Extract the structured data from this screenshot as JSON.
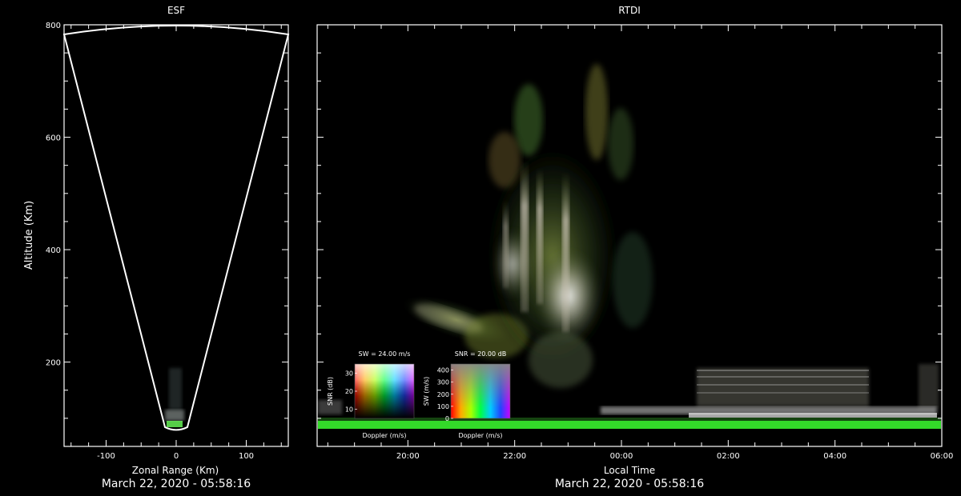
{
  "chart_data": [
    {
      "type": "scatter",
      "title": "ESF",
      "xlabel": "Zonal Range (Km)",
      "ylabel": "Altitude (Km)",
      "xlim": [
        -160,
        160
      ],
      "ylim": [
        50,
        800
      ],
      "x_ticks": [
        -100,
        0,
        100
      ],
      "y_ticks": [
        200,
        400,
        600,
        800
      ],
      "grid": false,
      "fan_beam": {
        "origin_altitude": 80,
        "edge_x_at_top": [
          -160,
          160
        ],
        "top_altitude": 800
      },
      "echo_region": {
        "x": [
          -20,
          15
        ],
        "altitude": [
          80,
          185
        ]
      },
      "footer": "March 22, 2020 - 05:58:16"
    },
    {
      "type": "heatmap",
      "title": "RTDI",
      "xlabel": "Local Time",
      "ylabel": "",
      "x_ticks": [
        "20:00",
        "22:00",
        "00:00",
        "02:00",
        "04:00",
        "06:00"
      ],
      "x_range_hours": [
        18.3,
        30.0
      ],
      "ylim": [
        50,
        800
      ],
      "y_ticks": [
        200,
        400,
        600,
        800
      ],
      "grid": false,
      "echo_events": [
        {
          "name": "plume",
          "time_hours": [
            21.6,
            23.5
          ],
          "altitude": [
            170,
            710
          ]
        },
        {
          "name": "bottomside_layer",
          "time_hours": [
            19.2,
            22.9
          ],
          "altitude": [
            180,
            280
          ]
        },
        {
          "name": "e_region_band",
          "time_hours": [
            18.3,
            30.0
          ],
          "altitude": [
            80,
            88
          ]
        },
        {
          "name": "post_midnight_layer",
          "time_hours": [
            25.3,
            29.5
          ],
          "altitude": [
            100,
            145
          ]
        }
      ],
      "legend_sw": {
        "title": "SW = 24.00 m/s",
        "ylabel": "SNR (dB)",
        "xlabel": "Doppler (m/s)",
        "y_ticks": [
          10,
          20,
          30
        ]
      },
      "legend_snr": {
        "title": "SNR = 20.00 dB",
        "ylabel": "SW (m/s)",
        "xlabel": "Doppler (m/s)",
        "y_ticks": [
          0,
          100,
          200,
          300,
          400
        ]
      },
      "footer": "March 22, 2020 - 05:58:16"
    }
  ]
}
